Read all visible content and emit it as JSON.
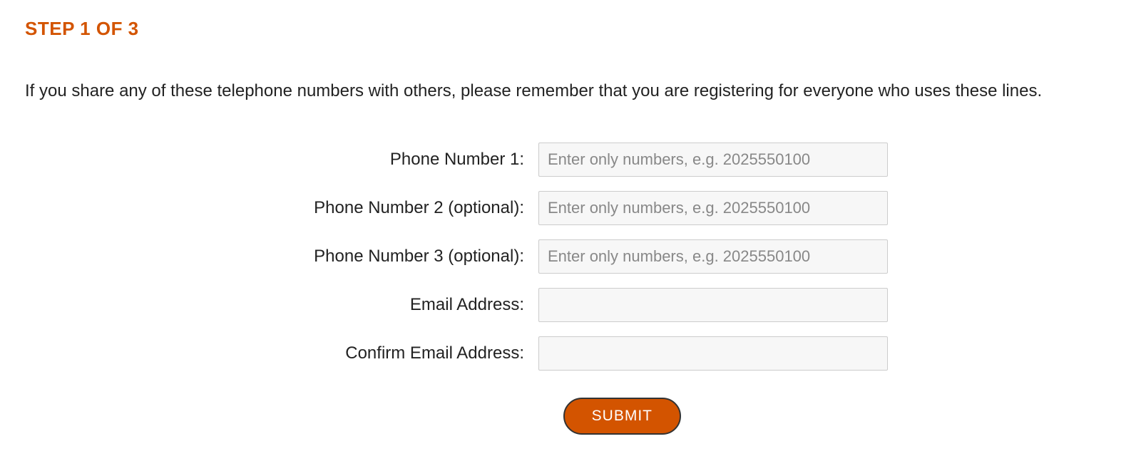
{
  "heading": "STEP 1 OF 3",
  "instruction": "If you share any of these telephone numbers with others, please remember that you are registering for everyone who uses these lines.",
  "form": {
    "fields": [
      {
        "label": "Phone Number 1:",
        "placeholder": "Enter only numbers, e.g. 2025550100",
        "value": ""
      },
      {
        "label": "Phone Number 2 (optional):",
        "placeholder": "Enter only numbers, e.g. 2025550100",
        "value": ""
      },
      {
        "label": "Phone Number 3 (optional):",
        "placeholder": "Enter only numbers, e.g. 2025550100",
        "value": ""
      },
      {
        "label": "Email Address:",
        "placeholder": "",
        "value": ""
      },
      {
        "label": "Confirm Email Address:",
        "placeholder": "",
        "value": ""
      }
    ],
    "submit_label": "SUBMIT"
  },
  "colors": {
    "accent": "#d35400",
    "text": "#222222",
    "input_bg": "#f7f7f7",
    "input_border": "#cccccc",
    "placeholder": "#888888"
  }
}
